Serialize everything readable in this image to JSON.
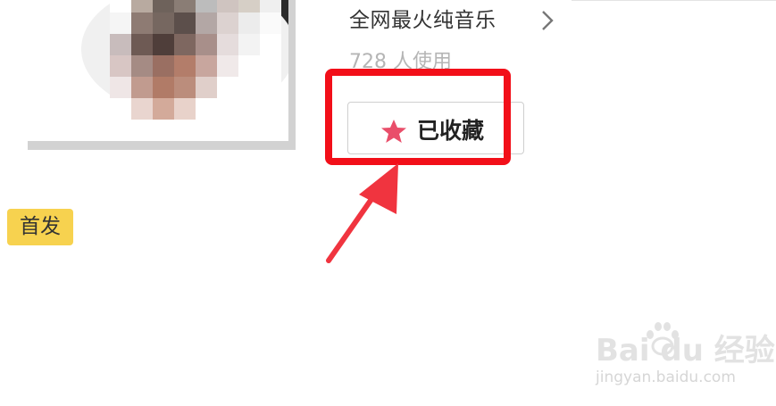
{
  "music": {
    "title": "全网最火纯音乐",
    "usage_count": "728 人使用"
  },
  "favorite_button": {
    "label": "已收藏",
    "icon": "star-icon",
    "icon_color": "#e94e6a"
  },
  "tag": {
    "label": "首发",
    "color": "#f7d24f"
  },
  "annotation": {
    "highlight_color": "#f20f19",
    "arrow_color": "#f0343f"
  },
  "watermark": {
    "logo": "Bai du 经验",
    "url": "jingyan.baidu.com"
  }
}
